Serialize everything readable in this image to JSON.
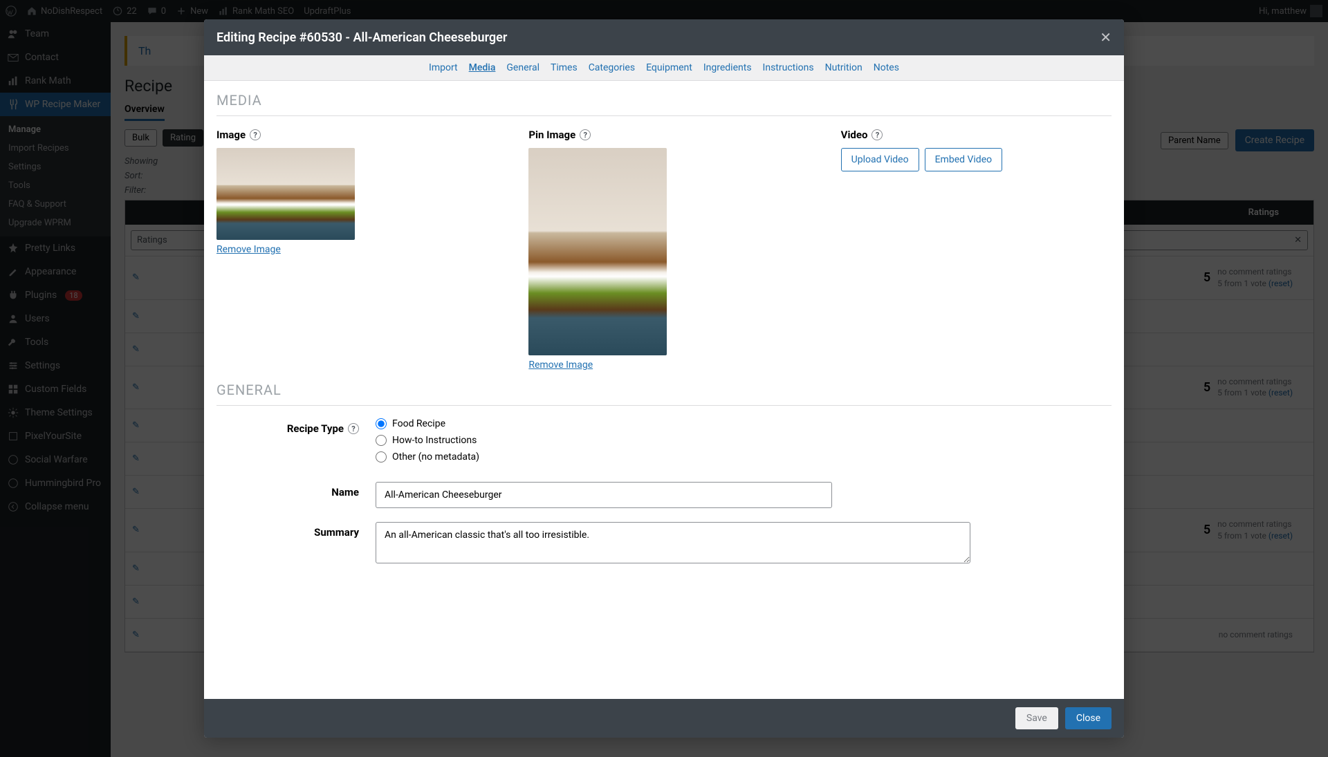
{
  "adminbar": {
    "site_name": "NoDishRespect",
    "updates": "22",
    "comments": "0",
    "new": "New",
    "rankmath": "Rank Math SEO",
    "updraft": "UpdraftPlus",
    "greeting": "Hi, matthew"
  },
  "sidebar": {
    "items": [
      {
        "label": "Team",
        "icon": "users"
      },
      {
        "label": "Contact",
        "icon": "mail"
      },
      {
        "label": "Rank Math",
        "icon": "chart"
      },
      {
        "label": "WP Recipe Maker",
        "icon": "fork",
        "active": true
      },
      {
        "label": "Pretty Links",
        "icon": "star"
      },
      {
        "label": "Appearance",
        "icon": "brush"
      },
      {
        "label": "Plugins",
        "icon": "plug",
        "badge": "18"
      },
      {
        "label": "Users",
        "icon": "user"
      },
      {
        "label": "Tools",
        "icon": "wrench"
      },
      {
        "label": "Settings",
        "icon": "sliders"
      },
      {
        "label": "Custom Fields",
        "icon": "grid"
      },
      {
        "label": "Theme Settings",
        "icon": "gear"
      },
      {
        "label": "PixelYourSite",
        "icon": "square"
      },
      {
        "label": "Social Warfare",
        "icon": "refresh"
      },
      {
        "label": "Hummingbird Pro",
        "icon": "circle"
      },
      {
        "label": "Collapse menu",
        "icon": "collapse"
      }
    ],
    "sub": [
      "Manage",
      "Import Recipes",
      "Settings",
      "Tools",
      "FAQ & Support",
      "Upgrade WPRM"
    ]
  },
  "page": {
    "notice_link": "Th",
    "title": "Recipe",
    "tabs": [
      "Overview"
    ],
    "pills_left": [
      "Bulk",
      "Rating"
    ],
    "pills_right": [
      "Parent Name"
    ],
    "create_btn": "Create Recipe",
    "showing": "Showing",
    "sort": "Sort:",
    "filter": "Filter:",
    "table_header_ratings": "Ratings",
    "select_ratings": "Ratings",
    "rows": [
      {
        "rating": "5",
        "meta1": "no comment ratings",
        "meta2": "5 from 1 vote",
        "reset": "(reset)"
      },
      {
        "rating": "5",
        "meta1": "no comment ratings",
        "meta2": "5 from 1 vote",
        "reset": "(reset)"
      },
      {
        "rating": "5",
        "meta1": "no comment ratings",
        "meta2": "5 from 1 vote",
        "reset": "(reset)"
      },
      {
        "rating": "",
        "meta1": "no comment ratings",
        "meta2": "",
        "reset": ""
      }
    ]
  },
  "modal": {
    "title": "Editing Recipe #60530 - All-American Cheeseburger",
    "tabs": [
      "Import",
      "Media",
      "General",
      "Times",
      "Categories",
      "Equipment",
      "Ingredients",
      "Instructions",
      "Nutrition",
      "Notes"
    ],
    "active_tab": "Media",
    "section_media": "MEDIA",
    "image_label": "Image",
    "pin_label": "Pin Image",
    "video_label": "Video",
    "remove_image": "Remove Image",
    "upload_video": "Upload Video",
    "embed_video": "Embed Video",
    "section_general": "GENERAL",
    "recipe_type_label": "Recipe Type",
    "type_options": [
      "Food Recipe",
      "How-to Instructions",
      "Other (no metadata)"
    ],
    "name_label": "Name",
    "name_value": "All-American Cheeseburger",
    "summary_label": "Summary",
    "summary_value": "An all-American classic that's all too irresistible.",
    "save_btn": "Save",
    "close_btn": "Close"
  }
}
